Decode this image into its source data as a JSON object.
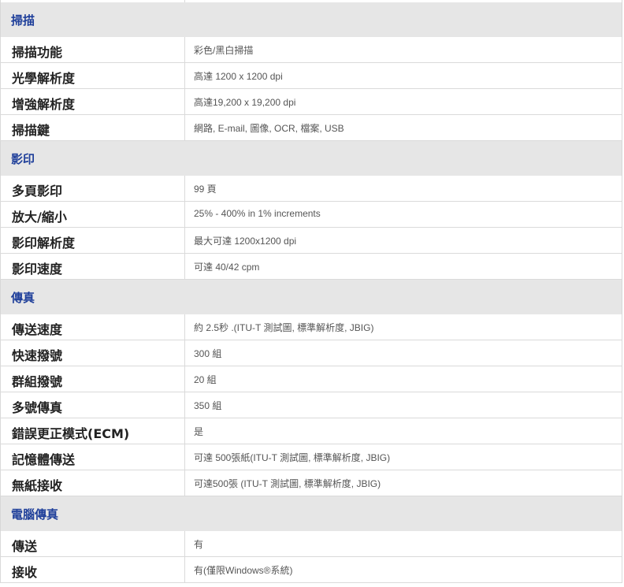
{
  "sections": [
    {
      "title": "掃描",
      "rows": [
        {
          "label": "掃描功能",
          "value": "彩色/黑白掃描"
        },
        {
          "label": "光學解析度",
          "value": "高達 1200 x 1200 dpi"
        },
        {
          "label": "增強解析度",
          "value": "高達19,200 x 19,200 dpi"
        },
        {
          "label": "掃描鍵",
          "value": "網路, E-mail, 圖像, OCR, 檔案, USB"
        }
      ]
    },
    {
      "title": "影印",
      "rows": [
        {
          "label": "多頁影印",
          "value": "99 頁"
        },
        {
          "label": "放大/縮小",
          "value": "25% - 400% in 1% increments"
        },
        {
          "label": "影印解析度",
          "value": "最大可達 1200x1200 dpi"
        },
        {
          "label": "影印速度",
          "value": "可達 40/42 cpm"
        }
      ]
    },
    {
      "title": "傳真",
      "rows": [
        {
          "label": "傳送速度",
          "value": "約 2.5秒 .(ITU-T 測試圖, 標準解析度, JBIG)"
        },
        {
          "label": "快速撥號",
          "value": "300 組"
        },
        {
          "label": "群組撥號",
          "value": "20 組"
        },
        {
          "label": "多號傳真",
          "value": "350 組"
        },
        {
          "label": "錯誤更正模式(ECM)",
          "value": "是"
        },
        {
          "label": "記憶體傳送",
          "value": "可達 500張紙(ITU-T 測試圖, 標準解析度, JBIG)"
        },
        {
          "label": "無紙接收",
          "value": "可達500張 (ITU-T 測試圖, 標準解析度, JBIG)"
        }
      ]
    },
    {
      "title": "電腦傳真",
      "rows": [
        {
          "label": "傳送",
          "value": "有"
        },
        {
          "label": "接收",
          "value": "有(僅限Windows®系統)"
        }
      ]
    }
  ]
}
